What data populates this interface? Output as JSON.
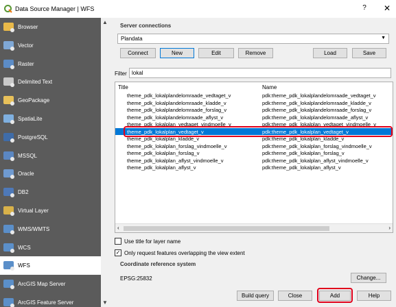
{
  "window": {
    "title": "Data Source Manager | WFS",
    "help_label": "?",
    "close_label": "✕"
  },
  "sidebar": {
    "items": [
      {
        "label": "Browser",
        "icon": "folder-icon",
        "color": "#e9b949"
      },
      {
        "label": "Vector",
        "icon": "vector-icon",
        "color": "#7fa8d6"
      },
      {
        "label": "Raster",
        "icon": "raster-icon",
        "color": "#5c8cc6"
      },
      {
        "label": "Delimited Text",
        "icon": "delimited-text-icon",
        "color": "#c9c9c9"
      },
      {
        "label": "GeoPackage",
        "icon": "geopackage-icon",
        "color": "#e8c15a"
      },
      {
        "label": "SpatiaLite",
        "icon": "spatialite-icon",
        "color": "#7fb0e0"
      },
      {
        "label": "PostgreSQL",
        "icon": "postgresql-icon",
        "color": "#3f6ca8"
      },
      {
        "label": "MSSQL",
        "icon": "mssql-icon",
        "color": "#5b87c2"
      },
      {
        "label": "Oracle",
        "icon": "oracle-icon",
        "color": "#6f9ad0"
      },
      {
        "label": "DB2",
        "icon": "db2-icon",
        "color": "#4e79b8"
      },
      {
        "label": "Virtual Layer",
        "icon": "virtual-layer-icon",
        "color": "#d9b24a"
      },
      {
        "label": "WMS/WMTS",
        "icon": "wms-icon",
        "color": "#5b8fc9"
      },
      {
        "label": "WCS",
        "icon": "wcs-icon",
        "color": "#5b8fc9"
      },
      {
        "label": "WFS",
        "icon": "wfs-icon",
        "color": "#5b8fc9"
      },
      {
        "label": "ArcGIS Map Server",
        "icon": "arcgis-map-icon",
        "color": "#5b8fc9"
      },
      {
        "label": "ArcGIS Feature Server",
        "icon": "arcgis-feature-icon",
        "color": "#5b8fc9"
      }
    ]
  },
  "server": {
    "group_title": "Server connections",
    "selected_connection": "Plandata",
    "buttons": {
      "connect": "Connect",
      "new": "New",
      "edit": "Edit",
      "remove": "Remove",
      "load": "Load",
      "save": "Save"
    }
  },
  "filter": {
    "label": "Filter",
    "value": "lokal"
  },
  "table": {
    "headers": {
      "title": "Title",
      "name": "Name"
    },
    "rows": [
      {
        "title": "theme_pdk_lokalplandelomraade_vedtaget_v",
        "name": "pdk:theme_pdk_lokalplandelomraade_vedtaget_v"
      },
      {
        "title": "theme_pdk_lokalplandelomraade_kladde_v",
        "name": "pdk:theme_pdk_lokalplandelomraade_kladde_v"
      },
      {
        "title": "theme_pdk_lokalplandelomraade_forslag_v",
        "name": "pdk:theme_pdk_lokalplandelomraade_forslag_v"
      },
      {
        "title": "theme_pdk_lokalplandelomraade_aflyst_v",
        "name": "pdk:theme_pdk_lokalplandelomraade_aflyst_v"
      },
      {
        "title": "theme_pdk_lokalplan_vedtaget_vindmoelle_v",
        "name": "pdk:theme_pdk_lokalplan_vedtaget_vindmoelle_v"
      },
      {
        "title": "theme_pdk_lokalplan_vedtaget_v",
        "name": "pdk:theme_pdk_lokalplan_vedtaget_v"
      },
      {
        "title": "theme_pdk_lokalplan_kladde_v",
        "name": "pdk:theme_pdk_lokalplan_kladde_v"
      },
      {
        "title": "theme_pdk_lokalplan_forslag_vindmoelle_v",
        "name": "pdk:theme_pdk_lokalplan_forslag_vindmoelle_v"
      },
      {
        "title": "theme_pdk_lokalplan_forslag_v",
        "name": "pdk:theme_pdk_lokalplan_forslag_v"
      },
      {
        "title": "theme_pdk_lokalplan_aflyst_vindmoelle_v",
        "name": "pdk:theme_pdk_lokalplan_aflyst_vindmoelle_v"
      },
      {
        "title": "theme_pdk_lokalplan_aflyst_v",
        "name": "pdk:theme_pdk_lokalplan_aflyst_v"
      }
    ],
    "selected_row": 5
  },
  "options": {
    "use_title": {
      "label": "Use title for layer name",
      "checked": false
    },
    "only_request": {
      "label": "Only request features overlapping the view extent",
      "checked": true
    }
  },
  "crs": {
    "group_title": "Coordinate reference system",
    "value": "EPSG:25832",
    "change_label": "Change..."
  },
  "footer": {
    "build_query": "Build query",
    "close": "Close",
    "add": "Add",
    "help": "Help"
  },
  "colors": {
    "selection": "#0078d7",
    "highlight": "#e0001b",
    "sidebar_bg": "#5b5b5b"
  }
}
